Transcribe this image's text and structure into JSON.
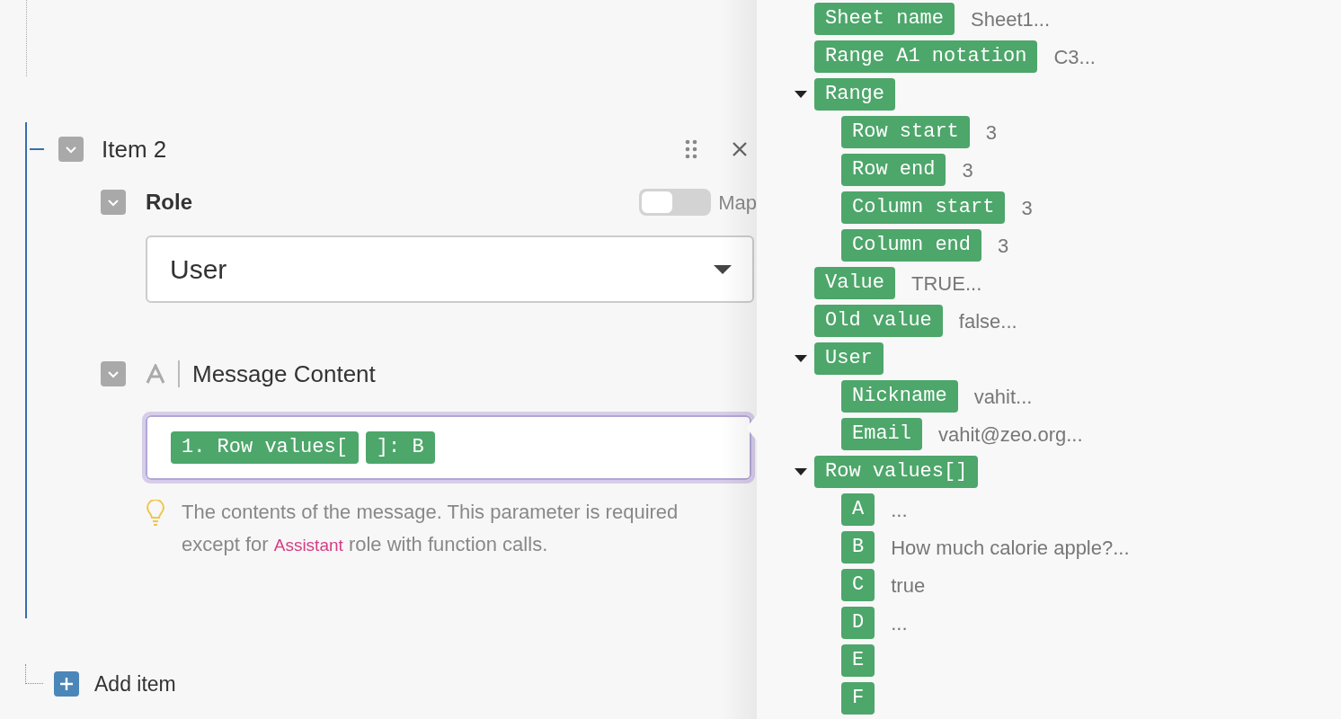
{
  "item": {
    "title": "Item 2",
    "expanded": true
  },
  "role": {
    "label": "Role",
    "expanded": true,
    "map_on": false,
    "map_label": "Map",
    "value": "User"
  },
  "message": {
    "label": "Message Content",
    "expanded": true,
    "tokens": [
      "1. Row values[",
      "]: B"
    ],
    "hint_before": "The contents of the message. This parameter is required except for",
    "hint_highlight": "Assistant",
    "hint_after": "role with function calls."
  },
  "add_item": "Add item",
  "tree": [
    {
      "label": "Sheet name",
      "value": "Sheet1..."
    },
    {
      "label": "Range A1 notation",
      "value": "C3..."
    },
    {
      "label": "Range",
      "expanded": true,
      "children": [
        {
          "label": "Row start",
          "value": "3"
        },
        {
          "label": "Row end",
          "value": "3"
        },
        {
          "label": "Column start",
          "value": "3"
        },
        {
          "label": "Column end",
          "value": "3"
        }
      ]
    },
    {
      "label": "Value",
      "value": "TRUE..."
    },
    {
      "label": "Old value",
      "value": "false..."
    },
    {
      "label": "User",
      "expanded": true,
      "children": [
        {
          "label": "Nickname",
          "value": "vahit..."
        },
        {
          "label": "Email",
          "value": "vahit@zeo.org..."
        }
      ]
    },
    {
      "label": "Row values[]",
      "expanded": true,
      "children": [
        {
          "label": "A",
          "value": "..."
        },
        {
          "label": "B",
          "value": "How much calorie apple?..."
        },
        {
          "label": "C",
          "value": "true"
        },
        {
          "label": "D",
          "value": "..."
        },
        {
          "label": "E"
        },
        {
          "label": "F"
        }
      ]
    }
  ]
}
